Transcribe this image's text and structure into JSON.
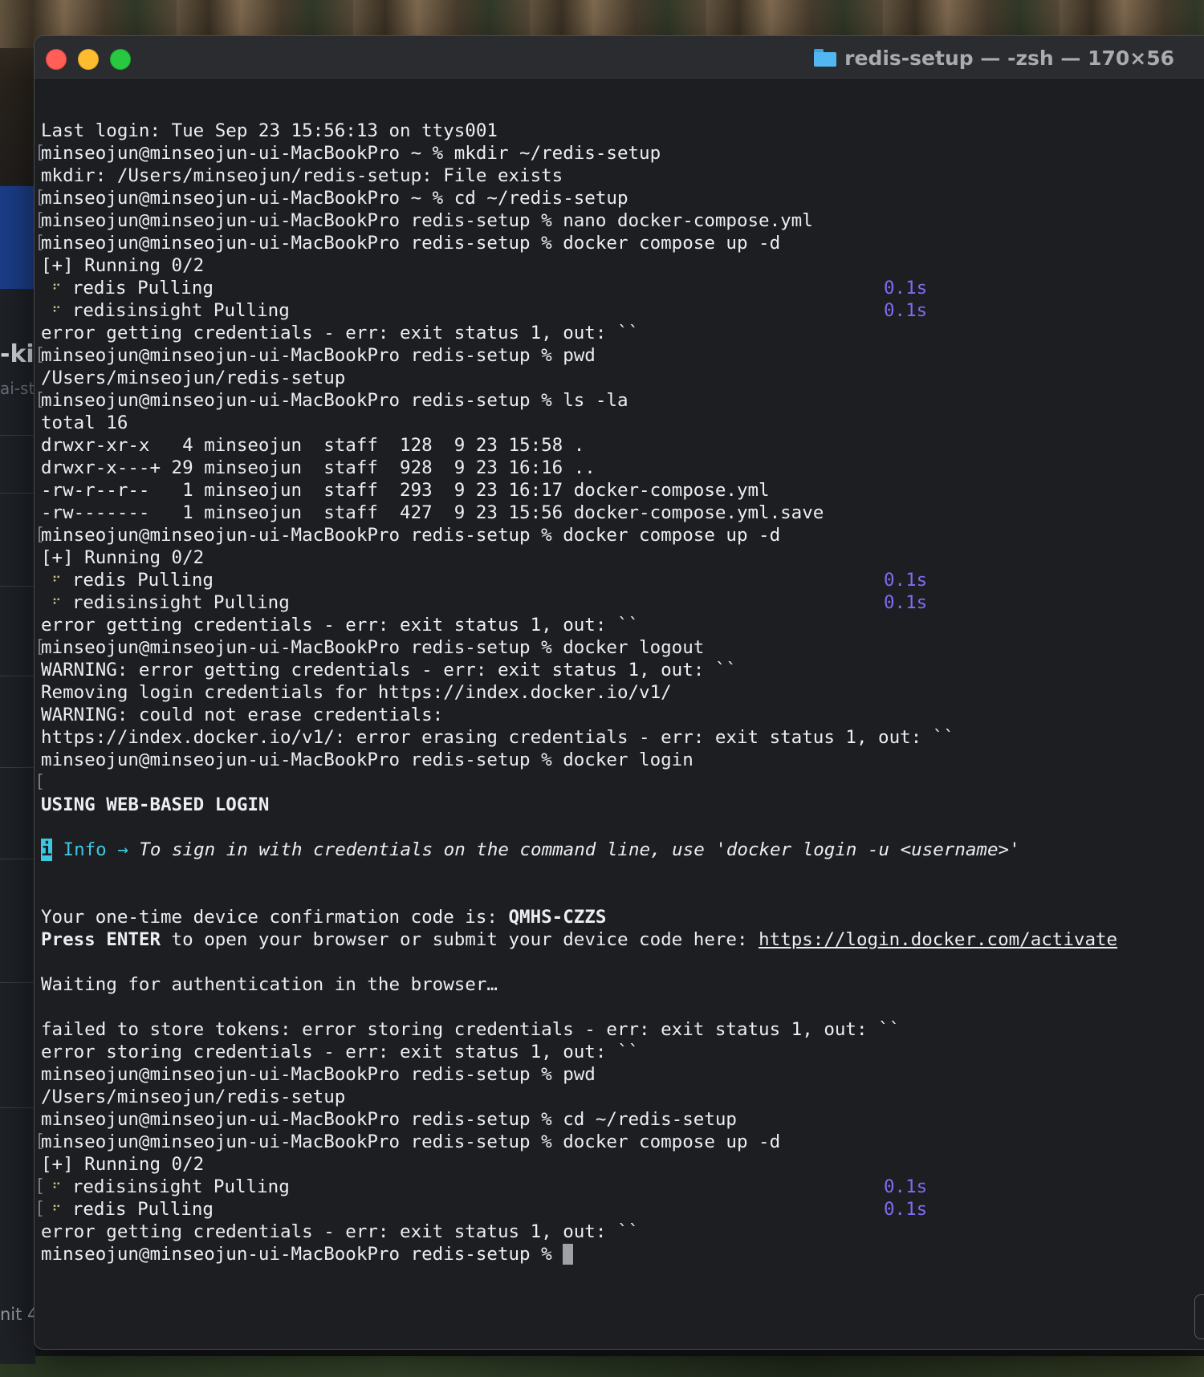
{
  "background_app": {
    "fragment_heading": "-ki",
    "fragment_sub": "ai-st",
    "fragment_bottom": "nit 4"
  },
  "window": {
    "title": "redis-setup — -zsh — 170×56",
    "folder_icon": "folder-icon",
    "buttons": [
      "close",
      "minimize",
      "zoom"
    ]
  },
  "terminal": {
    "colors": {
      "background": "#1d1e21",
      "foreground": "#eceef0",
      "timing": "#7d6cf5",
      "info": "#3dc7e0"
    },
    "lines": [
      "Last login: Tue Sep 23 15:56:13 on ttys001",
      "minseojun@minseojun-ui-MacBookPro ~ % mkdir ~/redis-setup",
      "mkdir: /Users/minseojun/redis-setup: File exists",
      "minseojun@minseojun-ui-MacBookPro ~ % cd ~/redis-setup",
      "minseojun@minseojun-ui-MacBookPro redis-setup % nano docker-compose.yml",
      "minseojun@minseojun-ui-MacBookPro redis-setup % docker compose up -d",
      "[+] Running 0/2",
      "redis Pulling",
      "redisinsight Pulling",
      "error getting credentials - err: exit status 1, out: ``",
      "minseojun@minseojun-ui-MacBookPro redis-setup % pwd",
      "/Users/minseojun/redis-setup",
      "minseojun@minseojun-ui-MacBookPro redis-setup % ls -la",
      "total 16",
      "drwxr-xr-x   4 minseojun  staff  128  9 23 15:58 .",
      "drwxr-x---+ 29 minseojun  staff  928  9 23 16:16 ..",
      "-rw-r--r--   1 minseojun  staff  293  9 23 16:17 docker-compose.yml",
      "-rw-------   1 minseojun  staff  427  9 23 15:56 docker-compose.yml.save",
      "minseojun@minseojun-ui-MacBookPro redis-setup % docker compose up -d",
      "[+] Running 0/2",
      "redis Pulling",
      "redisinsight Pulling",
      "error getting credentials - err: exit status 1, out: ``",
      "minseojun@minseojun-ui-MacBookPro redis-setup % docker logout",
      "WARNING: error getting credentials - err: exit status 1, out: ``",
      "Removing login credentials for https://index.docker.io/v1/",
      "WARNING: could not erase credentials:",
      "https://index.docker.io/v1/: error erasing credentials - err: exit status 1, out: ``",
      "minseojun@minseojun-ui-MacBookPro redis-setup % docker login",
      "",
      "USING WEB-BASED LOGIN",
      "",
      "To sign in with credentials on the command line, use 'docker login -u <username>'",
      "",
      "",
      "Your one-time device confirmation code is: ",
      " to open your browser or submit your device code here: ",
      "",
      "Waiting for authentication in the browser…",
      "",
      "failed to store tokens: error storing credentials - err: exit status 1, out: ``",
      "error storing credentials - err: exit status 1, out: ``",
      "minseojun@minseojun-ui-MacBookPro redis-setup % pwd",
      "/Users/minseojun/redis-setup",
      "minseojun@minseojun-ui-MacBookPro redis-setup % cd ~/redis-setup",
      "minseojun@minseojun-ui-MacBookPro redis-setup % docker compose up -d",
      "[+] Running 0/2",
      "redisinsight Pulling",
      "redis Pulling",
      "error getting credentials - err: exit status 1, out: ``",
      "minseojun@minseojun-ui-MacBookPro redis-setup % "
    ],
    "row_marker": "[",
    "spinner_glyph": "⠋",
    "timing": "0.1s",
    "info_icon": "i",
    "info_label": "Info →",
    "device_code": "QMHS-CZZS",
    "press_label": "Press ENTER",
    "activate_url": "https://login.docker.com/activate"
  }
}
